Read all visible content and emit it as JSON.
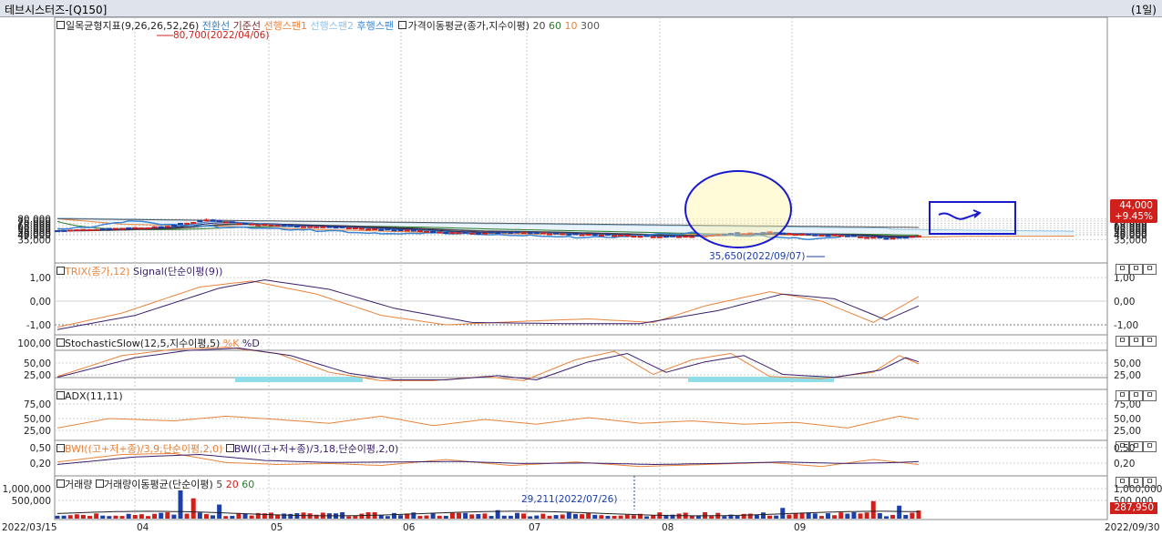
{
  "window": {
    "title": "테브시스터즈-[Q150]",
    "period": "(1일)"
  },
  "colors": {
    "up": "#d0201c",
    "down": "#1c3fa8",
    "tenkan": "#3a7fc1",
    "kijun": "#7b2d2d",
    "senkou1": "#e8843c",
    "senkou2": "#8fc4ea",
    "chikou": "#3a86d4",
    "ma20": "#444444",
    "ma60": "#2c7a2c",
    "ma10": "#1a1a6b",
    "ma300": "#555555",
    "annotation": "#1a1acc"
  },
  "main_panel": {
    "legend": {
      "ichimoku": "일목균형지표(9,26,26,52,26)",
      "tenkan": "전환선",
      "kijun": "기준선",
      "senkou1": "선행스팬1",
      "senkou2": "선행스팬2",
      "chikou": "후행스팬",
      "ma": "가격이동평균(종가,지수이평)",
      "ma_periods": [
        "20",
        "60",
        "10",
        "300"
      ]
    },
    "y_ticks_left": [
      "80,000",
      "75,000",
      "70,000",
      "65,000",
      "60,000",
      "55,000",
      "50,000",
      "45,000",
      "40,000",
      "35,000"
    ],
    "y_ticks_right": [
      "80,000",
      "75,000",
      "70,000",
      "65,000",
      "60,000",
      "55,000",
      "50,000",
      "45,000",
      "40,000",
      "35,000"
    ],
    "high_label": "80,700(2022/04/06)",
    "low_label": "35,650(2022/09/07)",
    "price_badge": {
      "price": "44,000",
      "change": "+9.45%"
    }
  },
  "trix_panel": {
    "legend": {
      "trix": "TRIX(종가,12)",
      "signal": "Signal(단순이평(9))"
    },
    "y_ticks_left": [
      "1,00",
      "0,00",
      "-1,00"
    ],
    "y_ticks_right": [
      "1,00",
      "0,00",
      "-1,00"
    ]
  },
  "stoch_panel": {
    "legend": {
      "name": "StochasticSlow(12,5,지수이평,5)",
      "k": "%K",
      "d": "%D"
    },
    "y_ticks_left": [
      "100,00",
      "50,00",
      "25,00"
    ],
    "y_ticks_right": [
      "50,00",
      "25,00"
    ]
  },
  "adx_panel": {
    "legend": {
      "name": "ADX(11,11)"
    },
    "y_ticks_left": [
      "75,00",
      "50,00",
      "25,00"
    ],
    "y_ticks_right": [
      "75,00",
      "50,00",
      "25,00"
    ]
  },
  "bwi_panel": {
    "legend": {
      "bwi1": "BWI((고+저+종)/3,9,단순이평,2,0)",
      "bwi2": "BWI((고+저+종)/3,18,단순이평,2,0)"
    },
    "y_ticks_left": [
      "0,50",
      "0,20"
    ],
    "y_ticks_right": [
      "0,50",
      "0,20"
    ]
  },
  "volume_panel": {
    "legend": {
      "name": "거래량",
      "ma": "거래량이동평균(단순이평)",
      "periods": [
        "5",
        "20",
        "60"
      ]
    },
    "y_ticks_left": [
      "1,000,000",
      "500,000"
    ],
    "y_ticks_right": [
      "1,000,000",
      "500,000"
    ],
    "low_label": "29,211(2022/07/26)",
    "volume_badge": "287,950"
  },
  "panel_controls": [
    "ㅁ",
    "ㅁ",
    "ㅁ"
  ],
  "x_axis": {
    "start_date": "2022/03/15",
    "end_date": "2022/09/30",
    "months": [
      "04",
      "05",
      "06",
      "07",
      "08",
      "09"
    ]
  }
}
